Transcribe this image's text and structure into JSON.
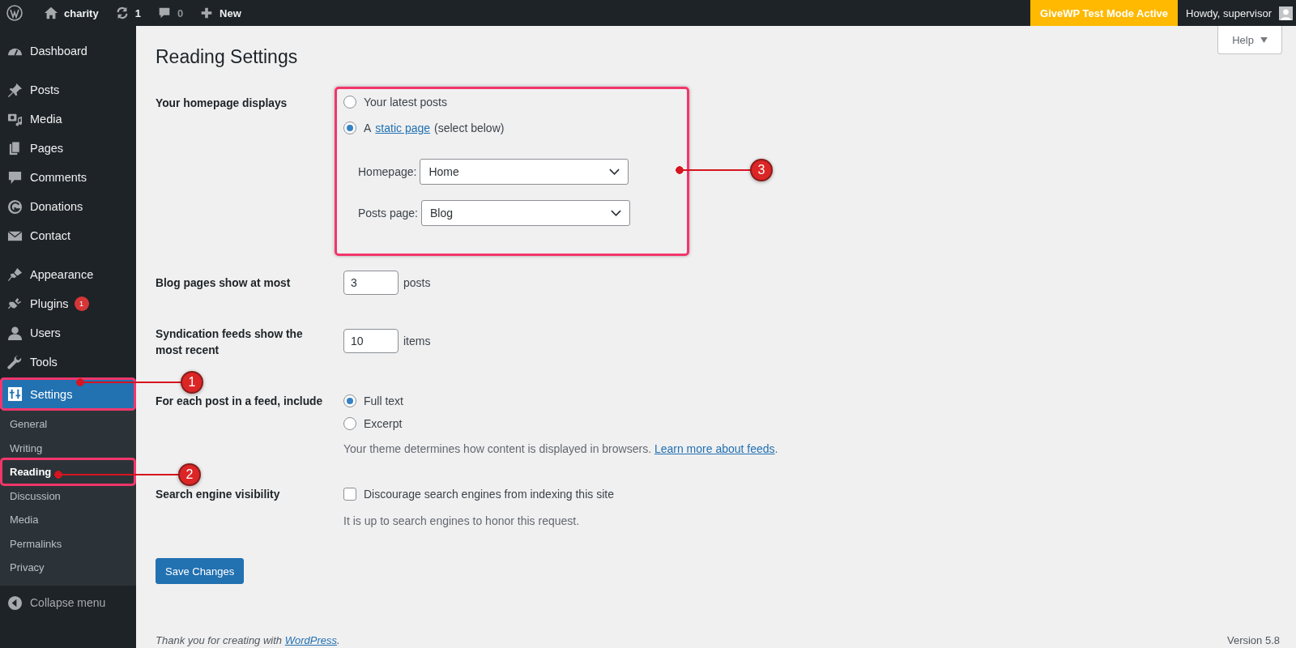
{
  "admin_bar": {
    "site": "charity",
    "updates": "1",
    "comments": "0",
    "new": "New",
    "notice": "GiveWP Test Mode Active",
    "greeting": "Howdy, supervisor"
  },
  "sidebar": {
    "groups": [
      [
        {
          "label": "Dashboard",
          "selected": false
        }
      ],
      [
        {
          "label": "Posts",
          "selected": false
        },
        {
          "label": "Media",
          "selected": false
        },
        {
          "label": "Pages",
          "selected": false
        },
        {
          "label": "Comments",
          "selected": false
        },
        {
          "label": "Donations",
          "selected": false
        },
        {
          "label": "Contact",
          "selected": false
        }
      ],
      [
        {
          "label": "Appearance",
          "selected": false
        },
        {
          "label": "Plugins",
          "selected": false,
          "badge": "1"
        },
        {
          "label": "Users",
          "selected": false
        },
        {
          "label": "Tools",
          "selected": false
        },
        {
          "label": "Settings",
          "selected": true
        }
      ]
    ],
    "submenu": [
      {
        "label": "General",
        "selected": false
      },
      {
        "label": "Writing",
        "selected": false
      },
      {
        "label": "Reading",
        "selected": true
      },
      {
        "label": "Discussion",
        "selected": false
      },
      {
        "label": "Media",
        "selected": false
      },
      {
        "label": "Permalinks",
        "selected": false
      },
      {
        "label": "Privacy",
        "selected": false
      }
    ],
    "collapse": "Collapse menu"
  },
  "help": "Help",
  "title": "Reading Settings",
  "rows": [
    {
      "kind": "radio-group",
      "label": "Your homepage displays",
      "options": [
        {
          "prefix": "Your latest posts",
          "selected": false
        },
        {
          "prefix": "A",
          "link": "static page",
          "suffix": "(select below)",
          "selected": true
        }
      ],
      "selects": [
        {
          "label": "Homepage:",
          "value": "Home"
        },
        {
          "label": "Posts page:",
          "value": "Blog"
        }
      ]
    },
    {
      "kind": "number",
      "label": "Blog pages show at most",
      "value": "3",
      "unit": "posts"
    },
    {
      "kind": "number",
      "label": "Syndication feeds show the most recent",
      "value": "10",
      "unit": "items"
    },
    {
      "kind": "radio-group",
      "label": "For each post in a feed, include",
      "options": [
        {
          "prefix": "Full text",
          "selected": true
        },
        {
          "prefix": "Excerpt",
          "selected": false
        }
      ],
      "description": "Your theme determines how content is displayed in browsers.",
      "description_link": "Learn more about feeds",
      "description_suffix": "."
    },
    {
      "kind": "checkbox",
      "label": "Search engine visibility",
      "option": "Discourage search engines from indexing this site",
      "checked": false,
      "description": "It is up to search engines to honor this request."
    }
  ],
  "save": "Save Changes",
  "footer": {
    "text": "Thank you for creating with",
    "link": "WordPress",
    "suffix": ".",
    "version": "Version 5.8"
  },
  "annotations": [
    {
      "number": "1"
    },
    {
      "number": "2"
    },
    {
      "number": "3"
    }
  ]
}
